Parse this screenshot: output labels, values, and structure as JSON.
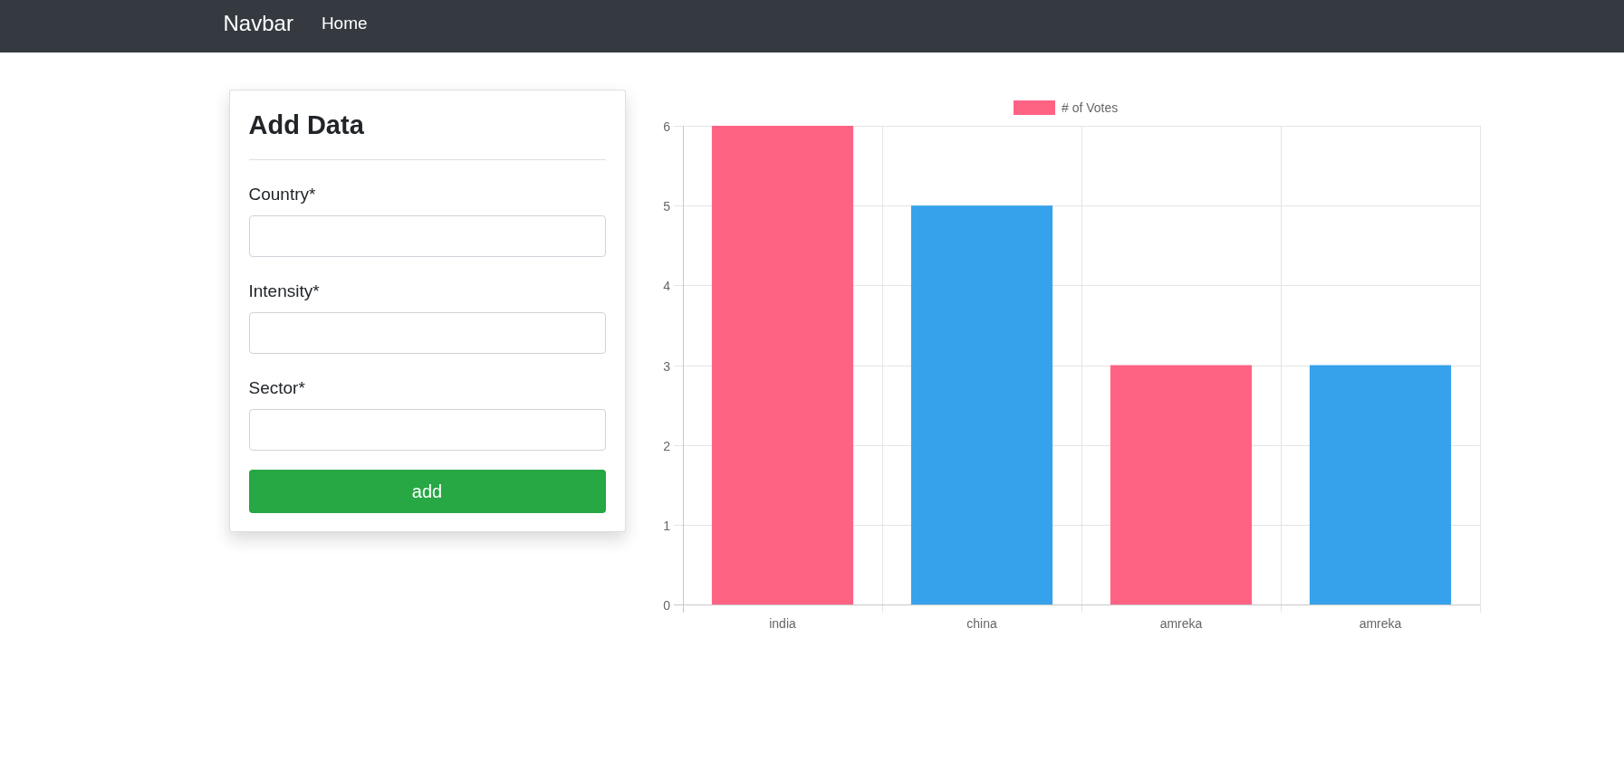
{
  "navbar": {
    "brand": "Navbar",
    "links": [
      {
        "label": "Home",
        "selected": true
      }
    ]
  },
  "form": {
    "title": "Add Data",
    "fields": [
      {
        "label": "Country*"
      },
      {
        "label": "Intensity*"
      },
      {
        "label": "Sector*"
      }
    ],
    "submit_button": "add"
  },
  "chart": {
    "chart_data": {
      "type": "bar",
      "categories": [
        "india",
        "china",
        "amreka",
        "amreka"
      ],
      "series": [
        {
          "name": "# of Votes",
          "color": "#ff6384",
          "colors": [
            "#ff6384",
            "#36a2eb",
            "#ff6384",
            "#36a2eb"
          ],
          "values": [
            6,
            5,
            3,
            3
          ]
        }
      ],
      "ylim": [
        0,
        6
      ],
      "yticks": [
        0,
        1,
        2,
        3,
        4,
        5,
        6
      ],
      "grid": true
    }
  }
}
